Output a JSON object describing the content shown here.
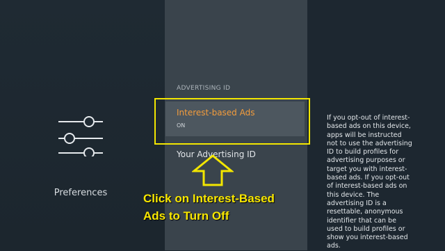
{
  "left_menu": {
    "preferences_label": "Preferences"
  },
  "center_menu": {
    "section_header": "ADVERTISING ID",
    "items": [
      {
        "title": "Interest-based Ads",
        "value": "ON",
        "selected": true
      },
      {
        "title": "Your Advertising ID"
      }
    ]
  },
  "annotation": {
    "line1": "Click on Interest-Based",
    "line2": "Ads to Turn Off"
  },
  "description": {
    "text": "If you opt-out of interest-based ads on this device, apps will be instructed not to use the advertising ID to build profiles for advertising purposes or target you with interest-based ads. If you opt-out of interest-based ads on this device. The advertising ID is a resettable, anonymous identifier that can be used to build profiles or show you interest-based ads."
  },
  "colors": {
    "accent": "#f39c3c",
    "highlight": "#f3e600",
    "annotation_text": "#f8e700"
  },
  "icons": [
    "sliders-icon",
    "up-arrow-icon"
  ]
}
